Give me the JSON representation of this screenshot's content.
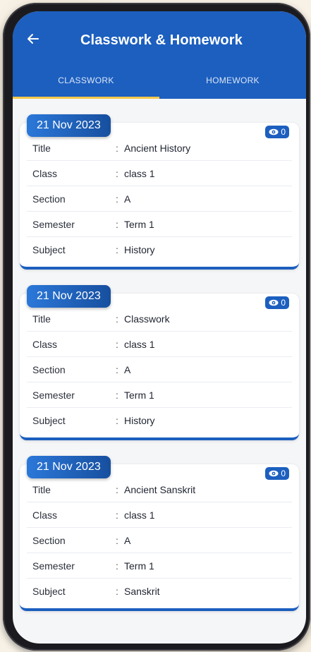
{
  "appbar": {
    "title": "Classwork & Homework",
    "back_icon": "arrow-left-icon"
  },
  "tabs": [
    {
      "label": "CLASSWORK",
      "active": true
    },
    {
      "label": "HOMEWORK",
      "active": false
    }
  ],
  "colors": {
    "primary": "#1c5fbf",
    "tab_indicator": "#f2c94c"
  },
  "cards": [
    {
      "date": "21 Nov 2023",
      "views": "0",
      "rows": [
        {
          "label": "Title",
          "value": "Ancient History"
        },
        {
          "label": "Class",
          "value": "class 1"
        },
        {
          "label": "Section",
          "value": "A"
        },
        {
          "label": "Semester",
          "value": "Term 1"
        },
        {
          "label": "Subject",
          "value": "History"
        }
      ]
    },
    {
      "date": "21 Nov 2023",
      "views": "0",
      "rows": [
        {
          "label": "Title",
          "value": "Classwork"
        },
        {
          "label": "Class",
          "value": "class 1"
        },
        {
          "label": "Section",
          "value": "A"
        },
        {
          "label": "Semester",
          "value": "Term 1"
        },
        {
          "label": "Subject",
          "value": "History"
        }
      ]
    },
    {
      "date": "21 Nov 2023",
      "views": "0",
      "rows": [
        {
          "label": "Title",
          "value": "Ancient Sanskrit"
        },
        {
          "label": "Class",
          "value": "class 1"
        },
        {
          "label": "Section",
          "value": "A"
        },
        {
          "label": "Semester",
          "value": "Term 1"
        },
        {
          "label": "Subject",
          "value": "Sanskrit"
        }
      ]
    }
  ]
}
